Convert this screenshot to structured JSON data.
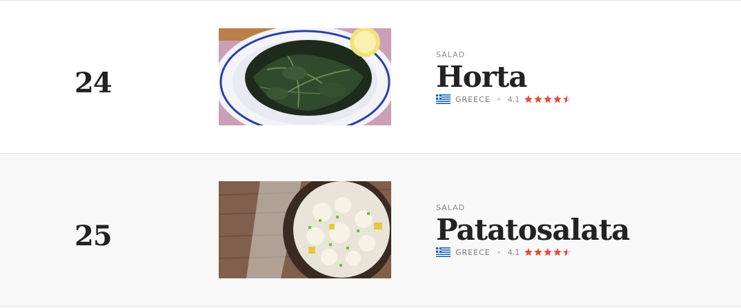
{
  "colors": {
    "star": "#e74c3c",
    "star_empty": "#dddddd",
    "greek_blue": "#0d5eaf"
  },
  "items": [
    {
      "rank": "24",
      "category": "SALAD",
      "name": "Horta",
      "country": "GREECE",
      "flag_icon": "greece-flag-icon",
      "rating": "4.1",
      "stars_value": 4.5,
      "image": "horta-dish-photo"
    },
    {
      "rank": "25",
      "category": "SALAD",
      "name": "Patatosalata",
      "country": "GREECE",
      "flag_icon": "greece-flag-icon",
      "rating": "4.1",
      "stars_value": 4.5,
      "image": "patatosalata-dish-photo"
    }
  ]
}
